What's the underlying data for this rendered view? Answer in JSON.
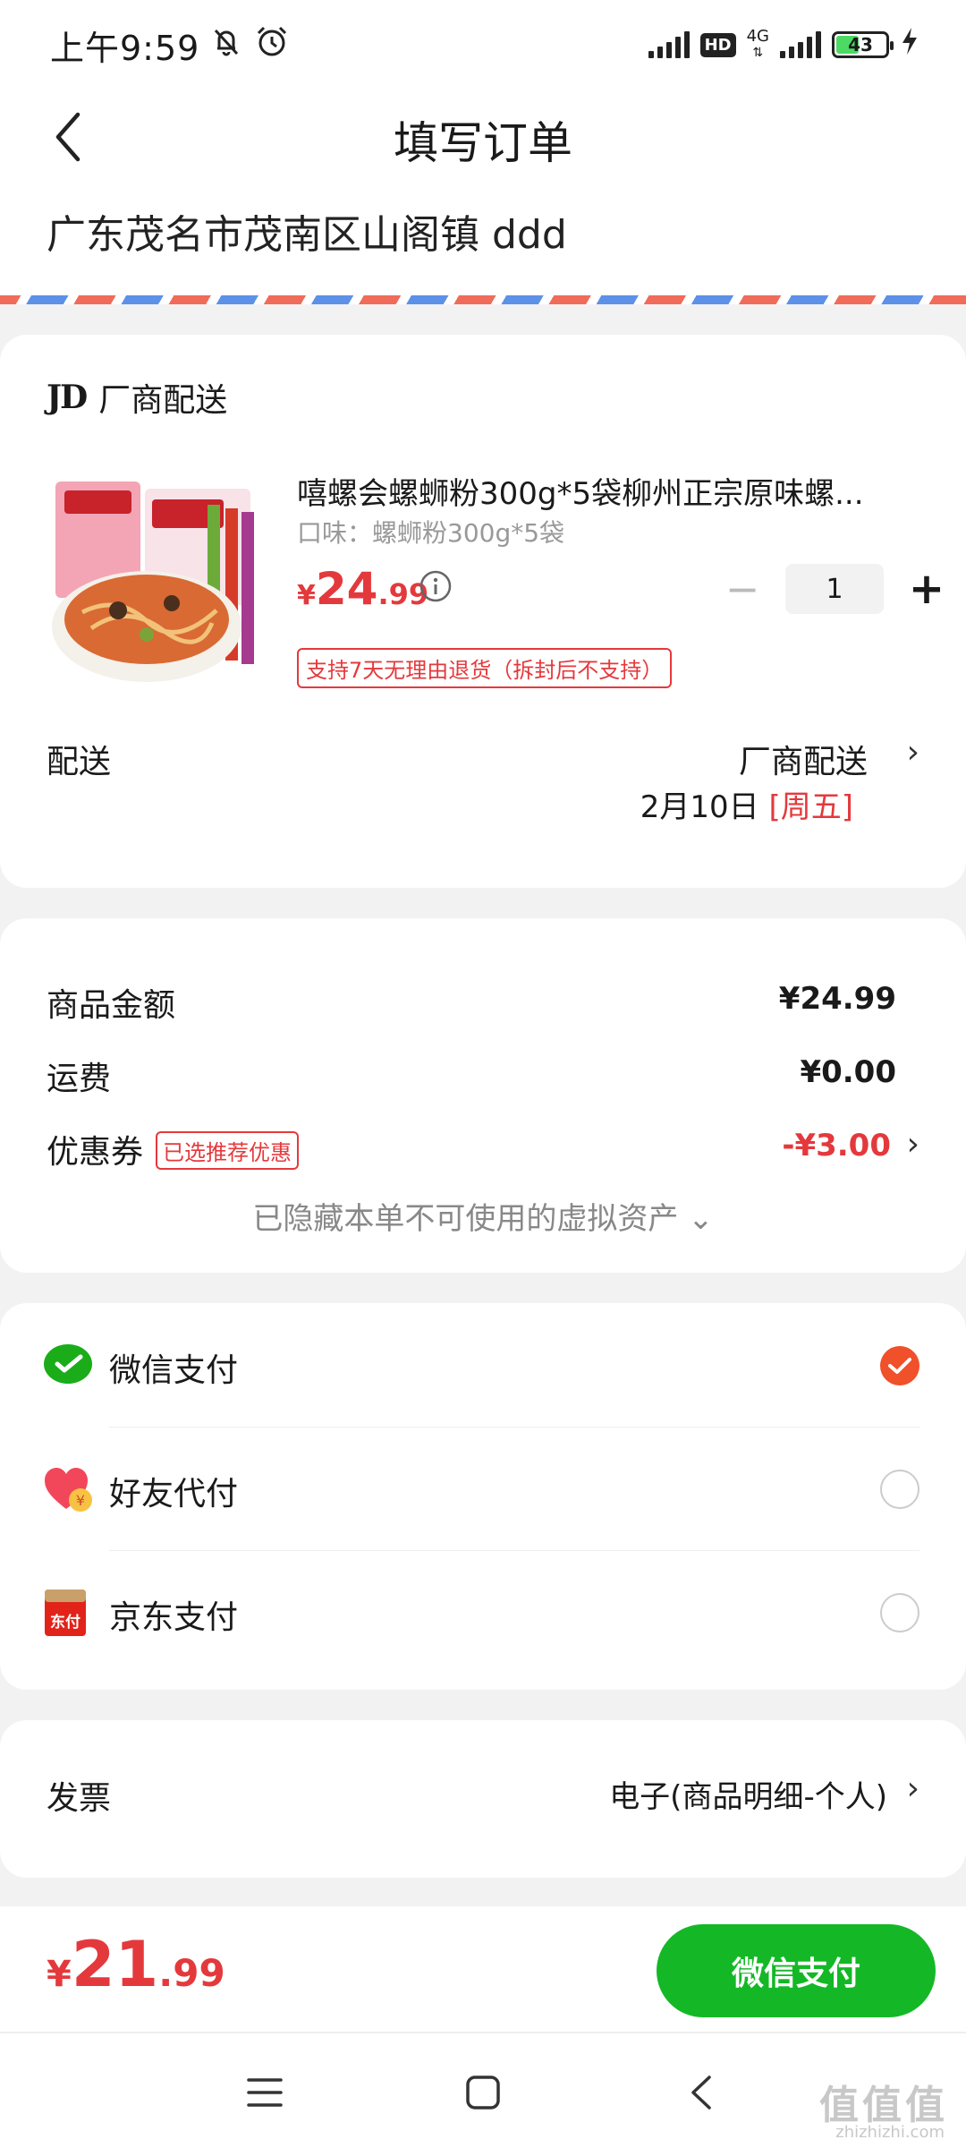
{
  "status_bar": {
    "time": "上午9:59",
    "network": "4G",
    "battery": "43"
  },
  "header": {
    "title": "填写订单"
  },
  "address": {
    "text": "广东茂名市茂南区山阁镇 ddd"
  },
  "order": {
    "vendor_logo": "JD",
    "vendor": "厂商配送",
    "product": {
      "name": "嘻螺会螺蛳粉300g*5袋柳州正宗原味螺...",
      "spec": "口味：螺蛳粉300g*5袋",
      "price_symbol": "¥",
      "price_int": "24",
      "price_dec": ".99",
      "quantity": "1",
      "return_policy": "支持7天无理由退货（拆封后不支持）"
    },
    "delivery": {
      "label": "配送",
      "method": "厂商配送",
      "date": "2月10日",
      "weekday": "[周五]"
    }
  },
  "summary": {
    "goods_label": "商品金额",
    "goods_value": "¥24.99",
    "shipping_label": "运费",
    "shipping_value": "¥0.00",
    "coupon_label": "优惠券",
    "coupon_tag": "已选推荐优惠",
    "coupon_value": "-¥3.00",
    "hidden_assets": "已隐藏本单不可使用的虚拟资产 ⌄"
  },
  "payment": {
    "options": [
      {
        "label": "微信支付",
        "selected": true,
        "icon": "wechat-pay-icon"
      },
      {
        "label": "好友代付",
        "selected": false,
        "icon": "friend-pay-icon"
      },
      {
        "label": "京东支付",
        "selected": false,
        "icon": "jd-pay-icon"
      }
    ]
  },
  "invoice": {
    "label": "发票",
    "value": "电子(商品明细-个人)"
  },
  "bottom": {
    "price_symbol": "¥",
    "total_int": "21",
    "total_dec": ".99",
    "pay_button": "微信支付"
  },
  "watermark": {
    "text": "值值值",
    "sub": "zhizhizhi.com"
  },
  "colors": {
    "accent_red": "#e4393c",
    "wechat_green": "#14b826",
    "radio_selected": "#f0502a"
  }
}
